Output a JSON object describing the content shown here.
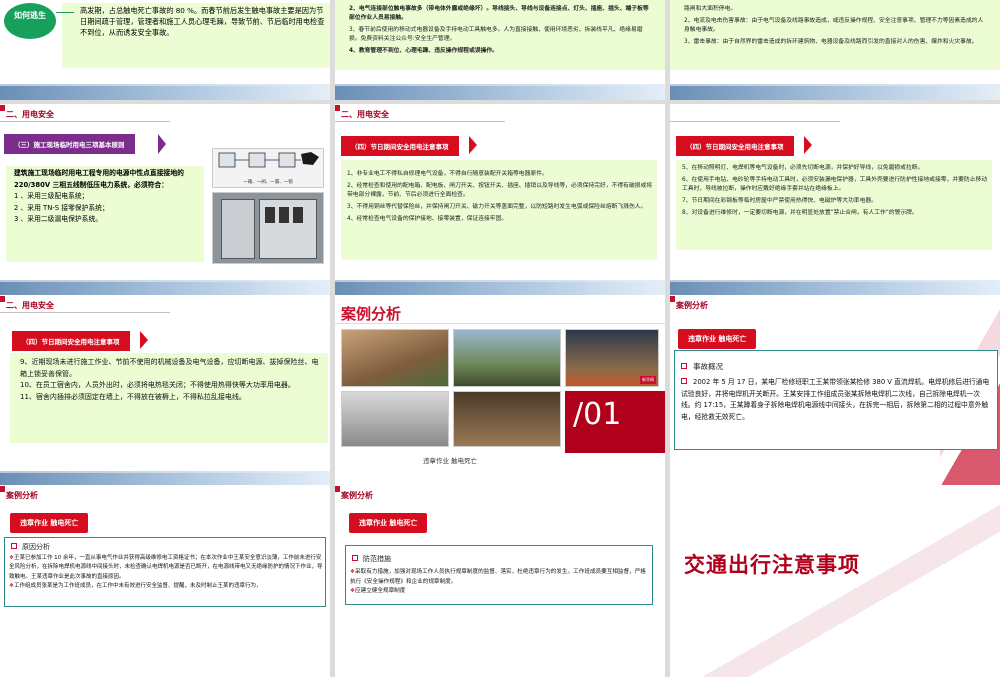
{
  "slide_a": {
    "badge": "如何逃生",
    "text": "高发期，占总触电死亡事故的 80 %。而春节前后发生触电事故主要是因为节日期间疏于管理，管理者和施工人员心理毛躁，导致节前、节后临时用电检查不到位，从而诱发安全事故。"
  },
  "slide_b": {
    "l2": "2、电气连接部位触电事故多（带电体外露或绝缘坏）。导线接头、导线与设备连接点、灯头、插座、插头、端子板等部位作业人员易接触。",
    "l3": "3、春节前后使用的移动式电器设备及手持电动工具触电多。人为直接接触、使用环境恶劣、拆装线平凡、绝缘易磨损。免费资料关注公众号:安全生产管理。",
    "l4": "4、教育管理不到位、心理毛躁、违反操作规程或误操作。"
  },
  "slide_c": {
    "l1": "路闸和大面积停电。",
    "l2": "2、电流及电击伤害事故：由于电气设备及线路事故造成，或违反操作规程、安全注意事项、管理不力等因素造成的人身触电事故。",
    "l3": "3、雷击事故：由于自然界的雷击造成的拆环建筑物、电器设备及线路而引发的直接对人的伤害、爆炸和火灾事故。"
  },
  "slide_d": {
    "section": "二、用电安全",
    "pill": "（三）施工现场临时用电三项基本原则",
    "body": "建筑施工现场临时用电工程专用的电源中性点直接接地的 220/380V 三相五线制低压电力系统，必须符合：",
    "items": [
      "1 、采用三级配电系统；",
      "2 、采用 TN-S 接零保护系统；",
      "3 、采用二级漏电保护系统。"
    ],
    "caption": "一箱、一闸、一漏、一锁"
  },
  "slide_e": {
    "section": "二、用电安全",
    "pill": "（四）节日期间安全用电注意事项",
    "items": [
      "1、非专业电工不得私自修理电气设备，不得自行随意装配开关箱等电器原件。",
      "2、经常检查和使用的配电箱、配电板、闸刀开关、按钮开关、插座、插销以及导线等，必须保持完好，不得有破损或将带电部分裸露，节前、节后必须进行全面检查。",
      "3、不得用铜丝等代替保险丝，并保持闸刀开关、磁力开关等盖面完整，以防短路时发生电弧或保险丝熔断飞溅伤人。",
      "4、经常检查电气设备的保护接地、接零装置，保证连接牢固。"
    ]
  },
  "slide_f": {
    "pill": "（四）节日期间安全用电注意事项",
    "items": [
      "5、在移动照明灯、电焊机等电气设备时，必须先切断电源，并保护好导线，以免磨损或拉断。",
      "6、在使用手电钻、电砂轮等手持电动工具时，必须安装漏电保护器，工具外壳要进行防护性接地或接零，并要防止移动工具时，导线被拉断，操作时应戴好绝缘手套并站在绝缘板上。",
      "7、节日期间在彩钢板等临时房屋中严禁使用热得快、电磁炉等大功率电器。",
      "8、对设备进行维修时，一定要切断电源，并在明显处放置“禁止合闸，有人工作”的警示牌。"
    ]
  },
  "slide_g": {
    "section": "二、用电安全",
    "pill": "（四）节日期间安全用电注意事项",
    "items": [
      "9、近期现场未进行施工作业、节前不使用的机械设备及电气设备，应切断电源、拔掉保险丝、电箱上锁妥善保管。",
      "10、在员工宿舍内，人员外出时，必须将电热毯关闭；不得使用热得快等大功率用电器。",
      "11、宿舍内插排必须固定在墙上，不得放在被褥上，不得私拉乱接电线。"
    ]
  },
  "slide_h": {
    "title": "案例分析",
    "caption": "违章作业 触电死亡",
    "number": "/01",
    "photo_tag": "新华网"
  },
  "slide_i": {
    "section": "案例分析",
    "pill": "违章作业  触电死亡",
    "heading": "事故概况",
    "body": "2002 年 5 月 17 日，某电厂检修班职工王某带领张某检修 380 V 直流焊机。电焊机修后进行通电试验良好，并将电焊机开关断开。王某安排工作组成员张某拆除电焊机二次线，自己拆除电焊机一次线。约 17:15，王某蹲着身子拆除电焊机电源线中间接头，在拆完一相后，拆除第二相的过程中意外触电，经抢救无效死亡。"
  },
  "slide_j": {
    "section": "案例分析",
    "pill": "违章作业  触电死亡",
    "heading": "原因分析",
    "items": [
      "王某已参加工作 10 余年，一直从事电气作业并获得高级维修电工资格证书；在本次作业中王某安全意识淡薄，工作前未进行安全风险分析，在拆除电焊机电源线中间接头时，未检查确认电焊机电源是否已断开，在电源线带电又无绝缘防护的情况下作业，导致触电。王某违章作业是此次事故的直接原因。",
      "工作组成员张某是为工作班成员，在工作中未有效进行安全监督、提醒，未及时制止王某的违章行为，"
    ]
  },
  "slide_k": {
    "section": "案例分析",
    "pill": "违章作业  触电死亡",
    "heading": "防范措施",
    "items": [
      "采取有力措施，加强对现场工作人员执行规章制度的监督、落实，杜绝违章行为的发生。工作班成员要互相监督，严格执行《安全操作规程》和企业的规章制度。",
      "应建立健全规章制度"
    ]
  },
  "slide_l": {
    "title": "交通出行注意事项"
  }
}
